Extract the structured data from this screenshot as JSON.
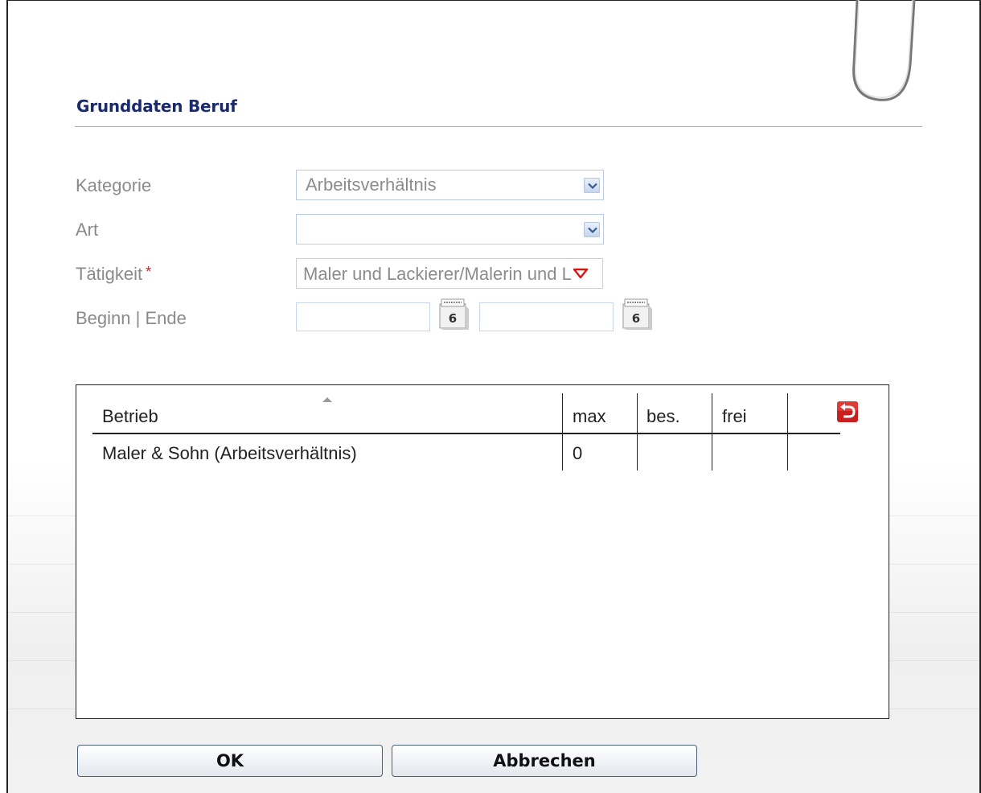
{
  "dialog": {
    "title": "Grunddaten Beruf"
  },
  "form": {
    "kategorie": {
      "label": "Kategorie",
      "value": "Arbeitsverhältnis"
    },
    "art": {
      "label": "Art",
      "value": ""
    },
    "taetigkeit": {
      "label": "Tätigkeit",
      "required_marker": "*",
      "value": "Maler und Lackierer/Malerin und Lackiererin"
    },
    "zeitraum": {
      "label": "Beginn | Ende",
      "begin_value": "",
      "end_value": ""
    }
  },
  "table": {
    "columns": [
      "Betrieb",
      "max",
      "bes.",
      "frei"
    ],
    "rows": [
      {
        "betrieb": "Maler & Sohn (Arbeitsverhältnis)",
        "max": "0",
        "bes": "",
        "frei": ""
      }
    ]
  },
  "buttons": {
    "ok": "OK",
    "cancel": "Abbrechen"
  },
  "icons": {
    "select_arrow": "chevron-down-icon",
    "combo_arrow": "triangle-down-icon",
    "calendar": "calendar-icon",
    "reset": "undo-icon",
    "sort": "sort-asc-icon"
  },
  "colors": {
    "title": "#1a2a6c",
    "label": "#8a8a8a",
    "required": "#cc2222",
    "reset_icon": "#c8201e"
  }
}
